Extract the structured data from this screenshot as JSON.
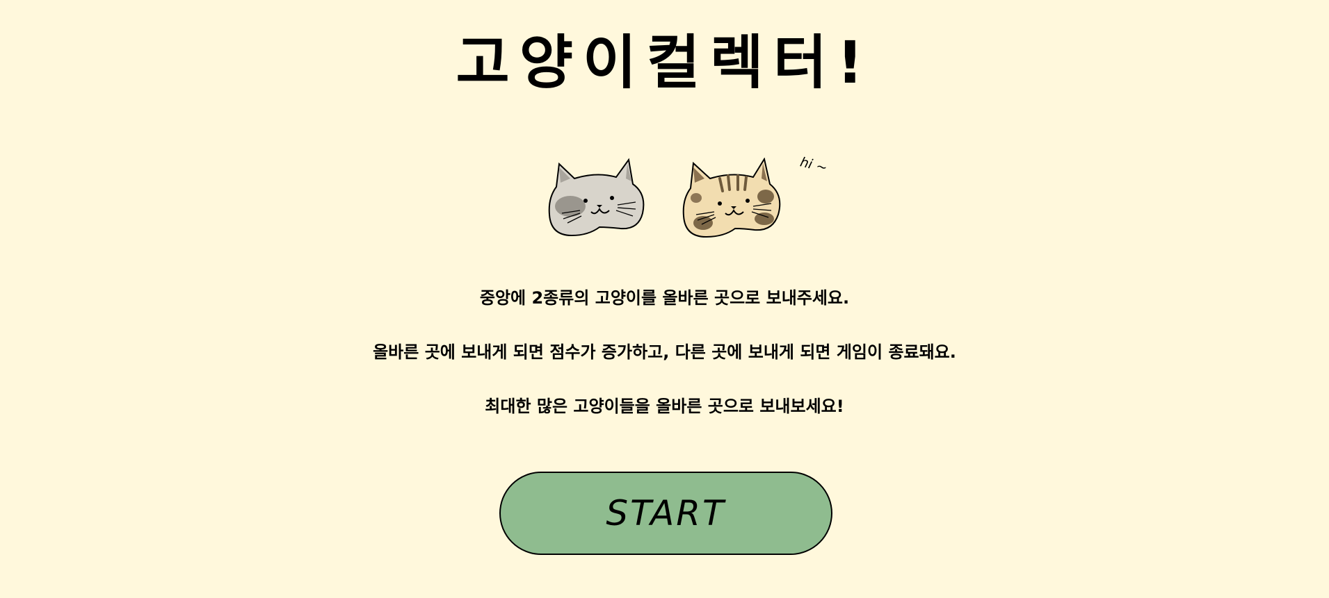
{
  "header": {
    "title": "고양이컬렉터!"
  },
  "illustration": {
    "speech": "hi ~",
    "cats": [
      {
        "name": "gray-cat-icon"
      },
      {
        "name": "tabby-cat-icon"
      }
    ]
  },
  "instructions": {
    "lines": [
      "중앙에 2종류의 고양이를 올바른 곳으로 보내주세요.",
      "올바른 곳에 보내게 되면 점수가 증가하고, 다른 곳에 보내게 되면 게임이 종료돼요.",
      "최대한 많은 고양이들을 올바른 곳으로 보내보세요!"
    ]
  },
  "start_button": {
    "label": "START"
  },
  "colors": {
    "background": "#fff8dc",
    "button": "#8fbc8f",
    "text": "#000000"
  }
}
